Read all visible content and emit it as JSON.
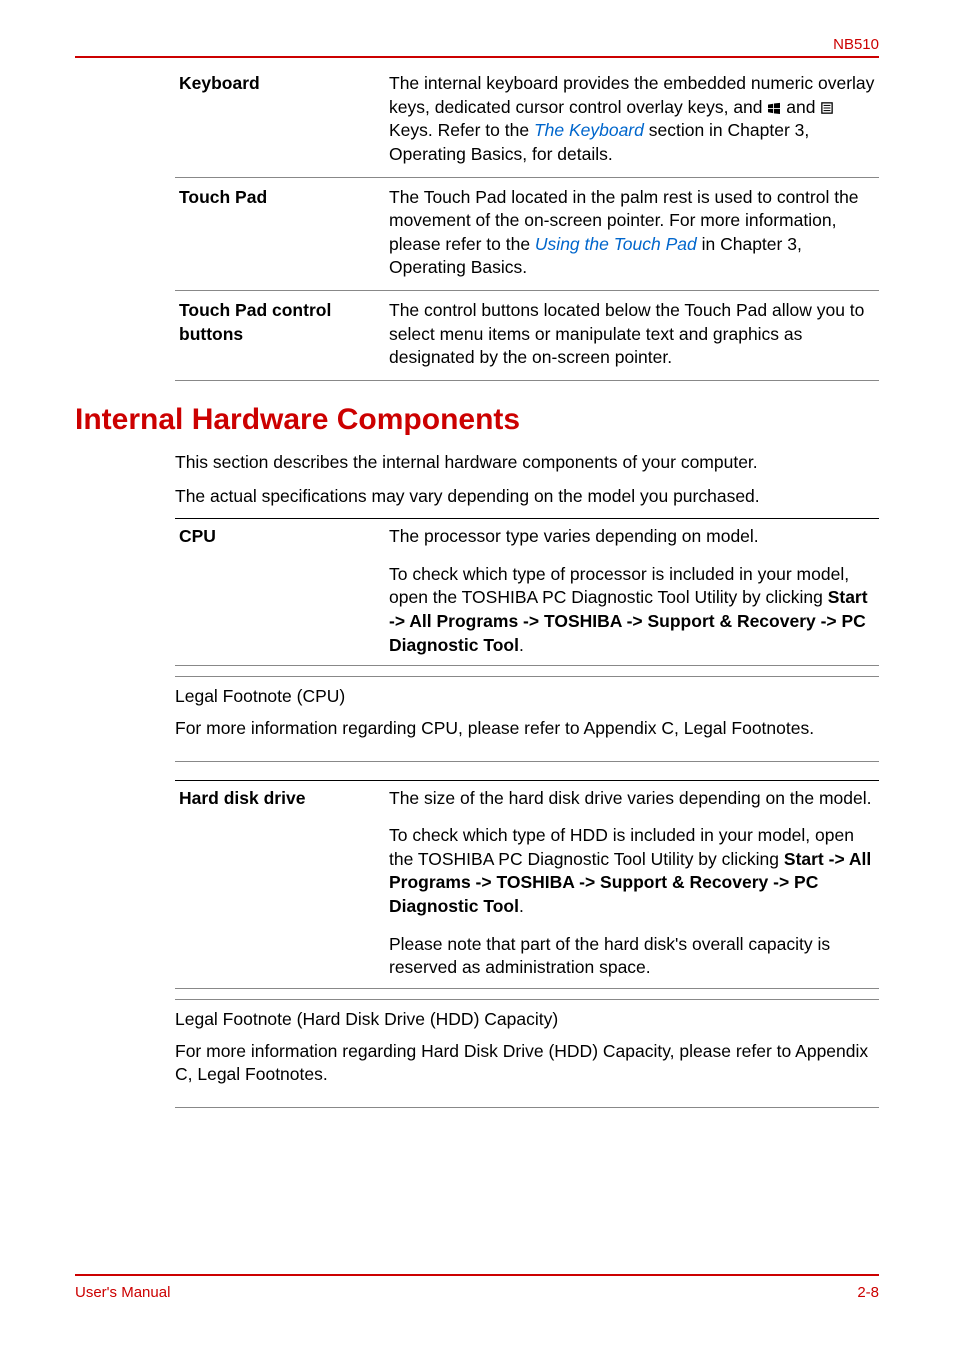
{
  "header": {
    "model": "NB510"
  },
  "topTable": {
    "rows": [
      {
        "term": "Keyboard",
        "desc_pre": "The internal keyboard provides the embedded numeric overlay keys, dedicated cursor control overlay keys, and ",
        "desc_mid": " and ",
        "desc_post": " Keys. Refer to the ",
        "link": "The Keyboard",
        "desc_end": " section in Chapter 3, Operating Basics, for details."
      },
      {
        "term": "Touch Pad",
        "desc_pre": "The Touch Pad located in the palm rest is used to control the movement of the on-screen pointer. For more information, please refer to the ",
        "link": "Using the Touch Pad",
        "desc_end": " in Chapter 3, Operating Basics."
      },
      {
        "term": "Touch Pad control buttons",
        "desc": "The control buttons located below the Touch Pad allow you to select menu items or manipulate text and graphics as designated by the on-screen pointer."
      }
    ]
  },
  "sectionHeading": "Internal Hardware Components",
  "introPara1": "This section describes the internal hardware components of your computer.",
  "introPara2": "The actual specifications may vary depending on the model you purchased.",
  "cpu": {
    "term": "CPU",
    "line1": "The processor type varies depending on model.",
    "line2_pre": "To check which type of processor is included in your model, open the TOSHIBA PC Diagnostic Tool Utility by clicking ",
    "line2_bold": "Start -> All Programs -> TOSHIBA -> Support & Recovery -> PC Diagnostic Tool",
    "line2_post": "."
  },
  "cpuFootnote": {
    "title": "Legal Footnote (CPU)",
    "body": "For more information regarding CPU, please refer to Appendix C, Legal Footnotes."
  },
  "hdd": {
    "term": "Hard disk drive",
    "line1": "The size of the hard disk drive varies depending on the model.",
    "line2_pre": "To check which type of HDD is included in your model, open the TOSHIBA PC Diagnostic Tool Utility by clicking ",
    "line2_bold": "Start -> All Programs -> TOSHIBA -> Support & Recovery -> PC Diagnostic Tool",
    "line2_post": ".",
    "line3": "Please note that part of the hard disk's overall capacity is reserved as administration space."
  },
  "hddFootnote": {
    "title": "Legal Footnote (Hard Disk Drive (HDD) Capacity)",
    "body": "For more information regarding Hard Disk Drive (HDD) Capacity, please refer to Appendix C, Legal Footnotes."
  },
  "footer": {
    "left": "User's Manual",
    "right": "2-8"
  },
  "icons": {
    "windows": "windows-key-icon",
    "menu": "menu-key-icon"
  }
}
